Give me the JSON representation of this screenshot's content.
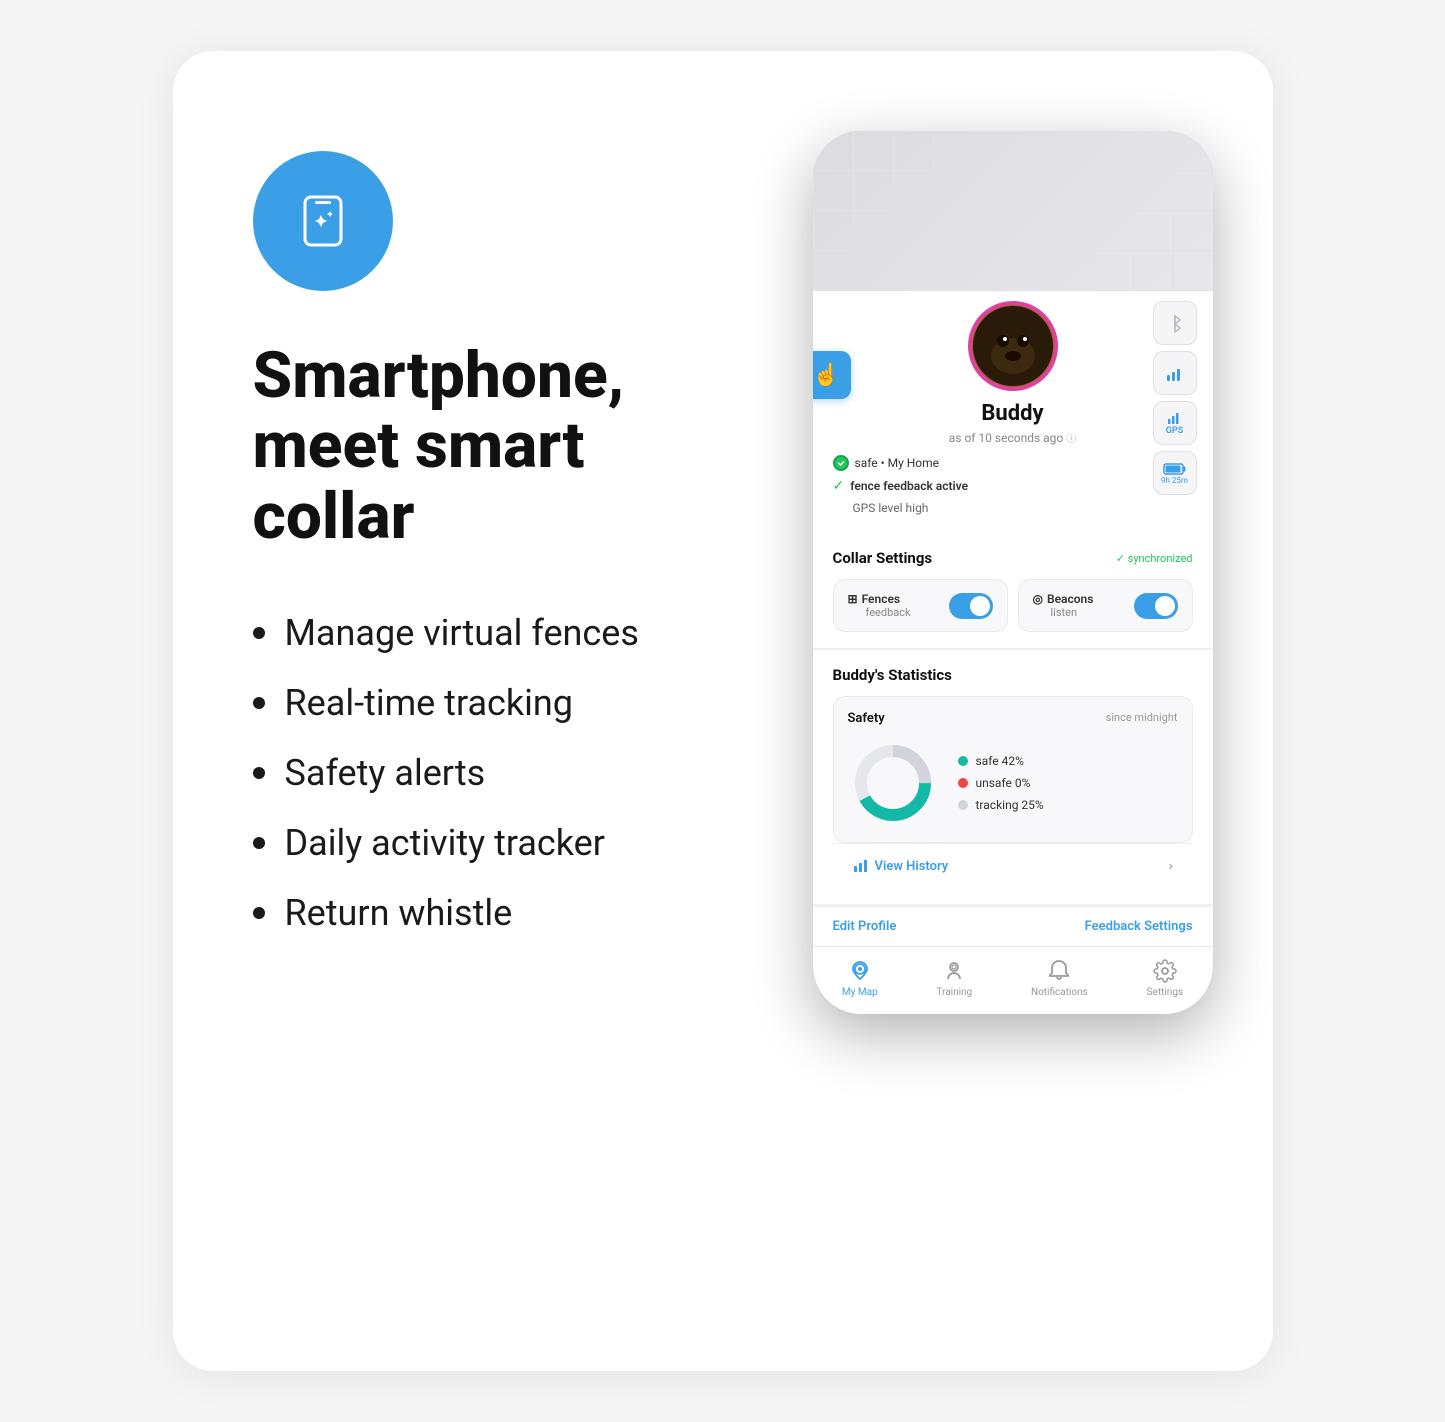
{
  "card": {
    "background": "#ffffff"
  },
  "left": {
    "headline": "Smartphone, meet smart collar",
    "features": [
      "Manage virtual fences",
      "Real-time tracking",
      "Safety alerts",
      "Daily activity tracker",
      "Return whistle"
    ]
  },
  "phone": {
    "dog_name": "Buddy",
    "timestamp": "as of 10 seconds ago",
    "status_safe": "safe • My Home",
    "status_fence": "fence feedback active",
    "status_gps": "GPS level high",
    "collar_settings_title": "Collar Settings",
    "synchronized": "✓ synchronized",
    "fences_label": "Fences",
    "fences_sub": "feedback",
    "beacons_label": "Beacons",
    "beacons_sub": "listen",
    "stats_title": "Buddy's Statistics",
    "safety_label": "Safety",
    "since_midnight": "since midnight",
    "safe_pct": "safe 42%",
    "unsafe_pct": "unsafe 0%",
    "tracking_pct": "tracking 25%",
    "view_history": "View History",
    "edit_profile": "Edit Profile",
    "feedback_settings": "Feedback Settings",
    "gps_label": "GPS",
    "battery_label": "9h 25m",
    "tabs": [
      {
        "label": "My Map",
        "active": true
      },
      {
        "label": "Training",
        "active": false
      },
      {
        "label": "Notifications",
        "active": false
      },
      {
        "label": "Settings",
        "active": false
      }
    ]
  },
  "donut": {
    "safe_pct": 42,
    "unsafe_pct": 0,
    "tracking_pct": 25,
    "rest_pct": 33
  }
}
